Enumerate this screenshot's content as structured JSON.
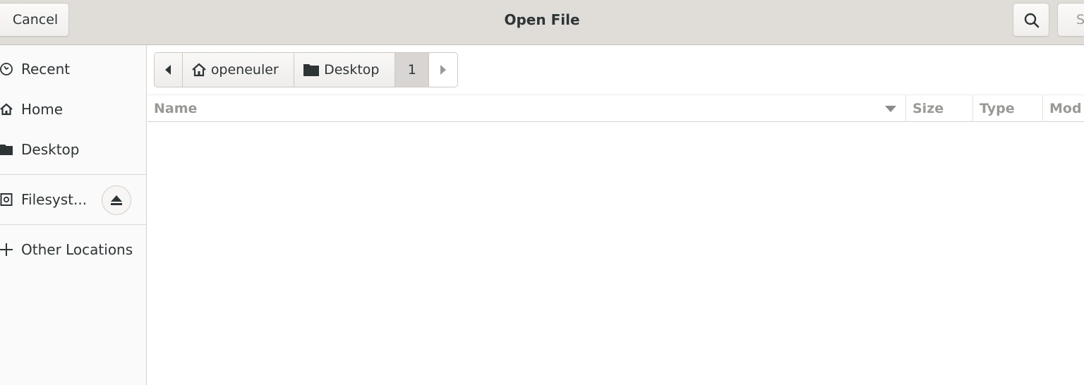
{
  "window": {
    "title": "Open File",
    "cancel_label": "Cancel",
    "select_label": "Select"
  },
  "sidebar": {
    "items": [
      {
        "label": "Recent",
        "icon": "clock-icon"
      },
      {
        "label": "Home",
        "icon": "home-icon"
      },
      {
        "label": "Desktop",
        "icon": "folder-icon"
      },
      {
        "label": "Filesyst...",
        "icon": "drive-icon"
      },
      {
        "label": "Other Locations",
        "icon": "plus-icon"
      }
    ]
  },
  "pathbar": {
    "crumbs": [
      {
        "label": "openeuler",
        "icon": "home-icon"
      },
      {
        "label": "Desktop",
        "icon": "folder-icon"
      },
      {
        "label": "1"
      }
    ]
  },
  "columns": {
    "name": "Name",
    "size": "Size",
    "type": "Type",
    "modified": "Mod"
  },
  "colors": {
    "headerbar": "#e0ddd9",
    "sidebar": "#fafafa",
    "active_crumb": "#d8d5d2"
  }
}
